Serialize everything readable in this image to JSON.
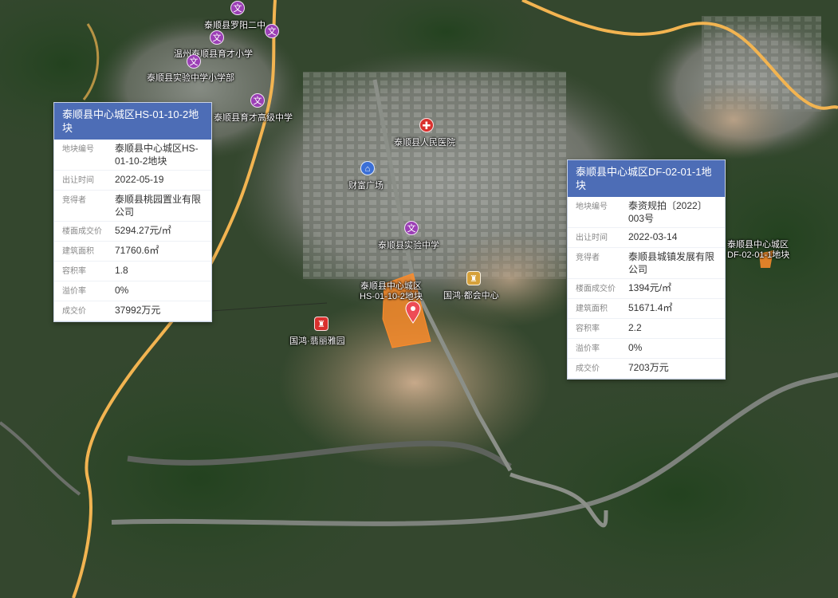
{
  "pois": [
    {
      "id": "luoyang2",
      "label": "泰顺县罗阳二中",
      "type": "school",
      "icon": "文"
    },
    {
      "id": "yucai",
      "label": "温州泰顺县育才小学",
      "type": "school",
      "icon": "文"
    },
    {
      "id": "shiyan-primary",
      "label": "泰顺县实验中学小学部",
      "type": "school",
      "icon": "文"
    },
    {
      "id": "yucai-high",
      "label": "泰顺县育才高级中学",
      "type": "school",
      "icon": "文"
    },
    {
      "id": "hospital",
      "label": "泰顺县人民医院",
      "type": "hospital",
      "icon": "✚"
    },
    {
      "id": "caifu",
      "label": "财富广场",
      "type": "mall",
      "icon": "⌂"
    },
    {
      "id": "shiyan",
      "label": "泰顺县实验中学",
      "type": "school",
      "icon": "文"
    },
    {
      "id": "guohong-dh",
      "label": "国鸿·都会中心",
      "type": "estate",
      "icon": "♜"
    },
    {
      "id": "guohong-fc",
      "label": "国鸿·翡丽雅园",
      "type": "estate",
      "icon": "♜"
    }
  ],
  "parcels": {
    "hs": {
      "label_line1": "泰顺县中心城区",
      "label_line2": "HS-01-10-2地块"
    },
    "df": {
      "label_line1": "泰顺县中心城区",
      "label_line2": "DF-02-01-1地块"
    }
  },
  "card_left": {
    "title": "泰顺县中心城区HS-01-10-2地块",
    "rows": [
      {
        "key": "地块编号",
        "value": "泰顺县中心城区HS-01-10-2地块"
      },
      {
        "key": "出让时间",
        "value": "2022-05-19"
      },
      {
        "key": "竞得者",
        "value": "泰顺县桃园置业有限公司"
      },
      {
        "key": "楼面成交价",
        "value": "5294.27元/㎡"
      },
      {
        "key": "建筑面积",
        "value": "71760.6㎡"
      },
      {
        "key": "容积率",
        "value": "1.8"
      },
      {
        "key": "溢价率",
        "value": "0%"
      },
      {
        "key": "成交价",
        "value": "37992万元"
      }
    ]
  },
  "card_right": {
    "title": "泰顺县中心城区DF-02-01-1地块",
    "rows": [
      {
        "key": "地块编号",
        "value": "泰资规拍〔2022〕003号"
      },
      {
        "key": "出让时间",
        "value": "2022-03-14"
      },
      {
        "key": "竞得者",
        "value": "泰顺县城镇发展有限公司"
      },
      {
        "key": "楼面成交价",
        "value": "1394元/㎡"
      },
      {
        "key": "建筑面积",
        "value": "51671.4㎡"
      },
      {
        "key": "容积率",
        "value": "2.2"
      },
      {
        "key": "溢价率",
        "value": "0%"
      },
      {
        "key": "成交价",
        "value": "7203万元"
      }
    ]
  },
  "colors": {
    "card_header": "#4d6db6",
    "parcel_fill": "#ff8c2a",
    "road_major": "#f2b451",
    "marker": "#ee4b55"
  }
}
